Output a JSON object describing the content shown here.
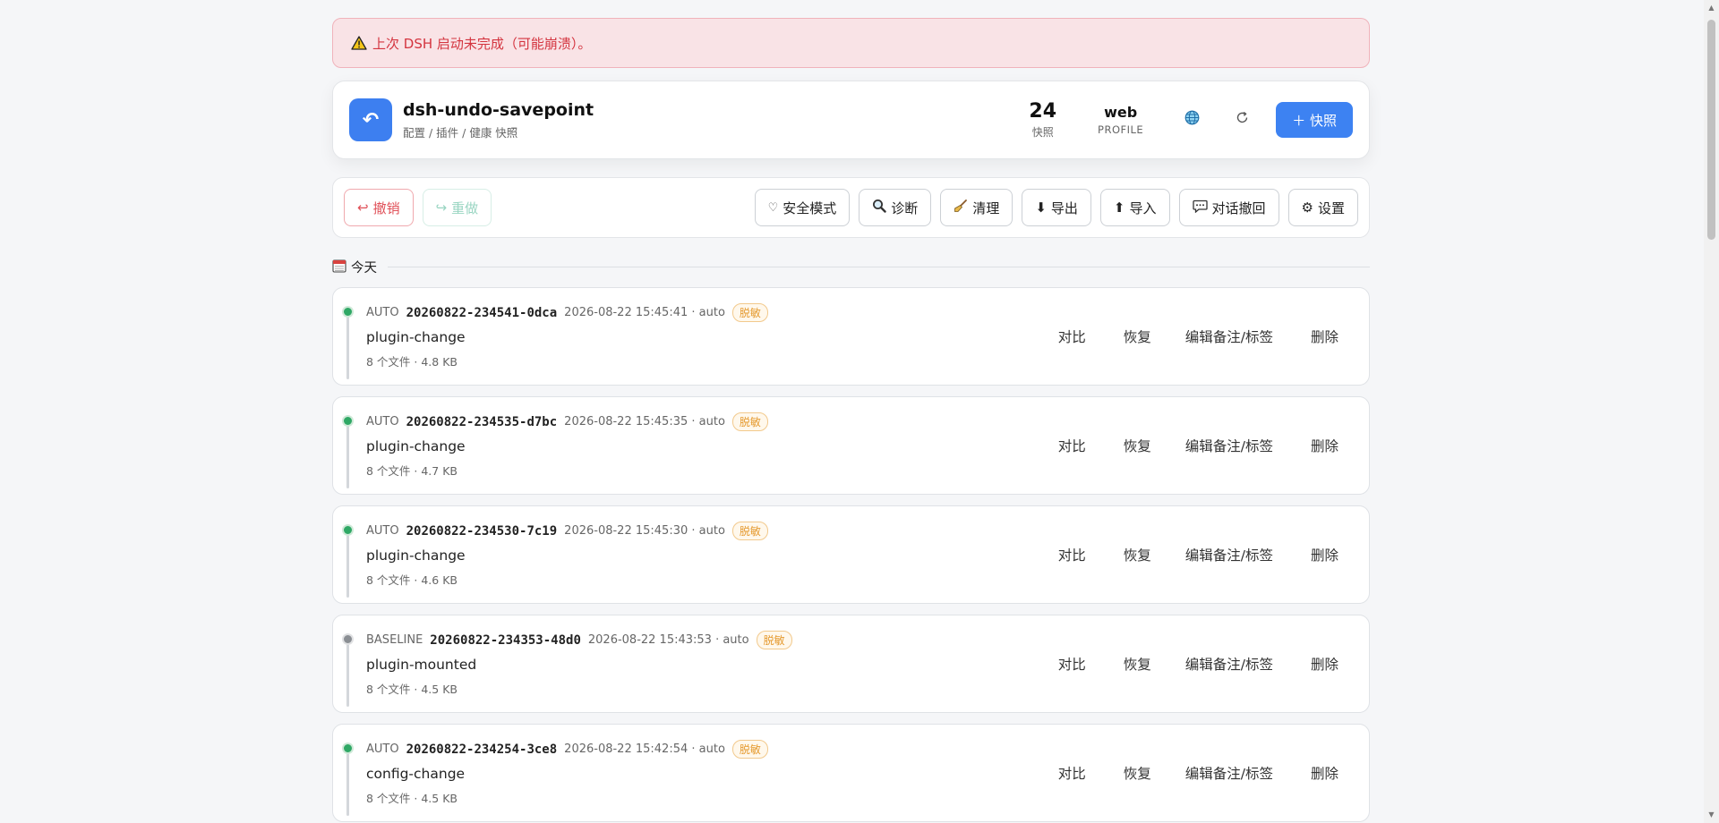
{
  "alert": {
    "icon": "warning-icon",
    "text": "上次 DSH 启动未完成（可能崩溃）。"
  },
  "header": {
    "app_icon": "undo-arrow-icon",
    "title": "dsh-undo-savepoint",
    "subtitle": "配置 / 插件 / 健康 快照",
    "snapshot_count": "24",
    "snapshot_label": "快照",
    "profile_value": "web",
    "profile_label": "PROFILE",
    "snapshot_button": "＋ 快照"
  },
  "toolbar": {
    "undo": "撤销",
    "redo": "重做",
    "safe_mode": "安全模式",
    "diagnose": "诊断",
    "clean": "清理",
    "export": "导出",
    "import": "导入",
    "chat_undo": "对话撤回",
    "settings": "设置"
  },
  "section": {
    "title": "今天"
  },
  "actions": {
    "compare": "对比",
    "restore": "恢复",
    "edit": "编辑备注/标签",
    "delete": "删除"
  },
  "snapshots": [
    {
      "kind": "AUTO",
      "id": "20260822-234541-0dca",
      "meta": "2026-08-22 15:45:41 · auto",
      "badge": "脱敏",
      "name": "plugin-change",
      "size": "8 个文件 · 4.8 KB",
      "status": "green"
    },
    {
      "kind": "AUTO",
      "id": "20260822-234535-d7bc",
      "meta": "2026-08-22 15:45:35 · auto",
      "badge": "脱敏",
      "name": "plugin-change",
      "size": "8 个文件 · 4.7 KB",
      "status": "green"
    },
    {
      "kind": "AUTO",
      "id": "20260822-234530-7c19",
      "meta": "2026-08-22 15:45:30 · auto",
      "badge": "脱敏",
      "name": "plugin-change",
      "size": "8 个文件 · 4.6 KB",
      "status": "green"
    },
    {
      "kind": "BASELINE",
      "id": "20260822-234353-48d0",
      "meta": "2026-08-22 15:43:53 · auto",
      "badge": "脱敏",
      "name": "plugin-mounted",
      "size": "8 个文件 · 4.5 KB",
      "status": "gray"
    },
    {
      "kind": "AUTO",
      "id": "20260822-234254-3ce8",
      "meta": "2026-08-22 15:42:54 · auto",
      "badge": "脱敏",
      "name": "config-change",
      "size": "8 个文件 · 4.5 KB",
      "status": "green"
    }
  ],
  "colors": {
    "accent": "#3d82f2",
    "alert_bg": "#f9e3e6",
    "alert_text": "#d4343f",
    "ok": "#2fa865",
    "baseline": "#8a8e93",
    "badge": "#e59a2f"
  }
}
